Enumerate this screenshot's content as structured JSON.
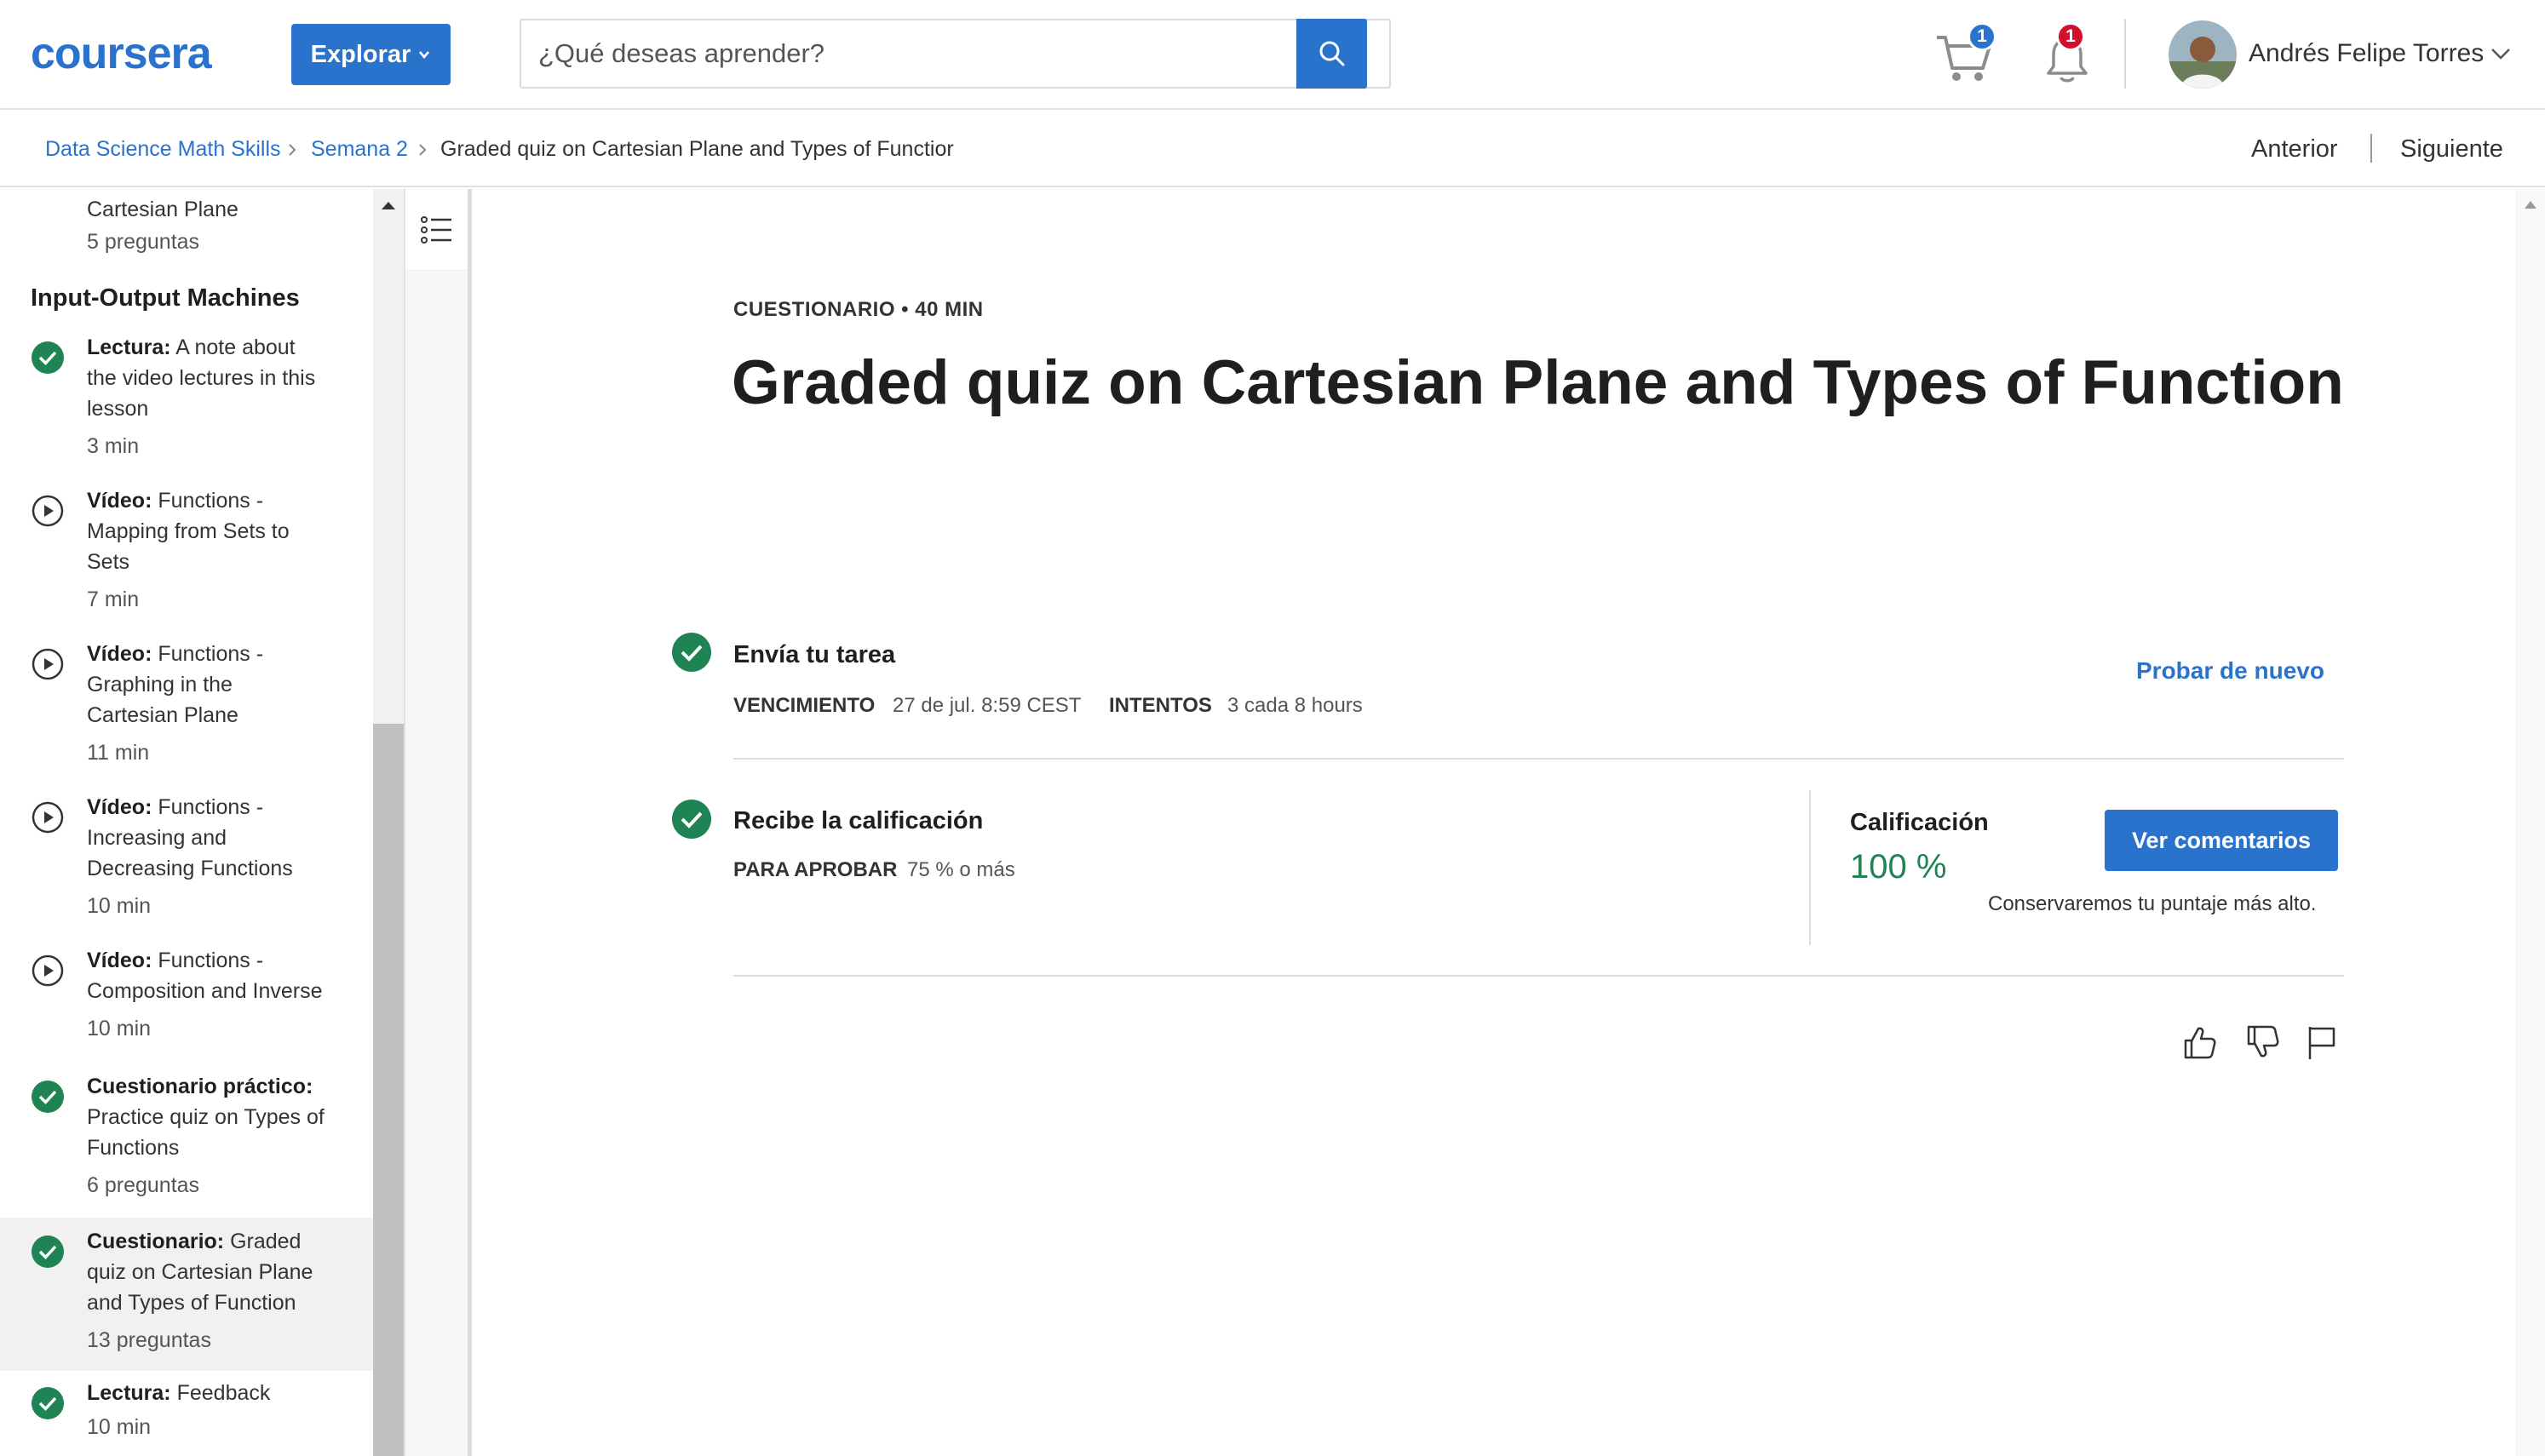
{
  "header": {
    "logo_text": "coursera",
    "explore_label": "Explorar",
    "search_placeholder": "¿Qué deseas aprender?",
    "cart_count": "1",
    "notification_count": "1",
    "user_name": "Andrés Felipe Torres"
  },
  "breadcrumb": {
    "items": [
      "Data Science Math Skills",
      "Semana 2",
      "Graded quiz on Cartesian Plane and Types of Functior"
    ],
    "prev_label": "Anterior",
    "next_label": "Siguiente"
  },
  "sidebar": {
    "top_item": {
      "text": "Cartesian Plane",
      "meta": "5 preguntas"
    },
    "section_title": "Input-Output Machines",
    "items": [
      {
        "type": "Lectura:",
        "text_lines": [
          "A note about",
          "the video lectures in this",
          "lesson"
        ],
        "meta": "3 min",
        "status": "completed"
      },
      {
        "type": "Vídeo:",
        "text_lines": [
          "Functions -",
          "Mapping from Sets to",
          "Sets"
        ],
        "meta": "7 min",
        "status": "video"
      },
      {
        "type": "Vídeo:",
        "text_lines": [
          "Functions -",
          "Graphing in the",
          "Cartesian Plane"
        ],
        "meta": "11 min",
        "status": "video"
      },
      {
        "type": "Vídeo:",
        "text_lines": [
          "Functions -",
          "Increasing and",
          "Decreasing Functions"
        ],
        "meta": "10 min",
        "status": "video"
      },
      {
        "type": "Vídeo:",
        "text_lines": [
          "Functions -",
          "Composition and Inverse"
        ],
        "meta": "10 min",
        "status": "video"
      },
      {
        "type": "Cuestionario práctico:",
        "text_lines": [
          "",
          "Practice quiz on Types of",
          "Functions"
        ],
        "meta": "6 preguntas",
        "status": "completed"
      },
      {
        "type": "Cuestionario:",
        "text_lines": [
          "Graded",
          "quiz on Cartesian Plane",
          "and Types of Function"
        ],
        "meta": "13 preguntas",
        "status": "completed"
      },
      {
        "type": "Lectura:",
        "text_lines": [
          "Feedback"
        ],
        "meta": "10 min",
        "status": "completed"
      }
    ]
  },
  "main": {
    "kicker": "CUESTIONARIO • 40 MIN",
    "title": "Graded quiz on Cartesian Plane and Types of Function",
    "submit": {
      "title": "Envía tu tarea",
      "due_label": "VENCIMIENTO",
      "due_value": "27 de jul. 8:59 CEST",
      "attempts_label": "INTENTOS",
      "attempts_value": "3 cada 8 hours",
      "retry_label": "Probar de nuevo"
    },
    "grade": {
      "title": "Recibe la calificación",
      "pass_label": "PARA APROBAR",
      "pass_value": "75 % o más",
      "grade_label": "Calificación",
      "grade_value": "100 %",
      "feedback_button": "Ver comentarios",
      "keep_note": "Conservaremos tu puntaje más alto."
    }
  },
  "colors": {
    "brand_blue": "#2a73cc",
    "success_green": "#1f8354",
    "alert_red": "#d30f2b"
  }
}
